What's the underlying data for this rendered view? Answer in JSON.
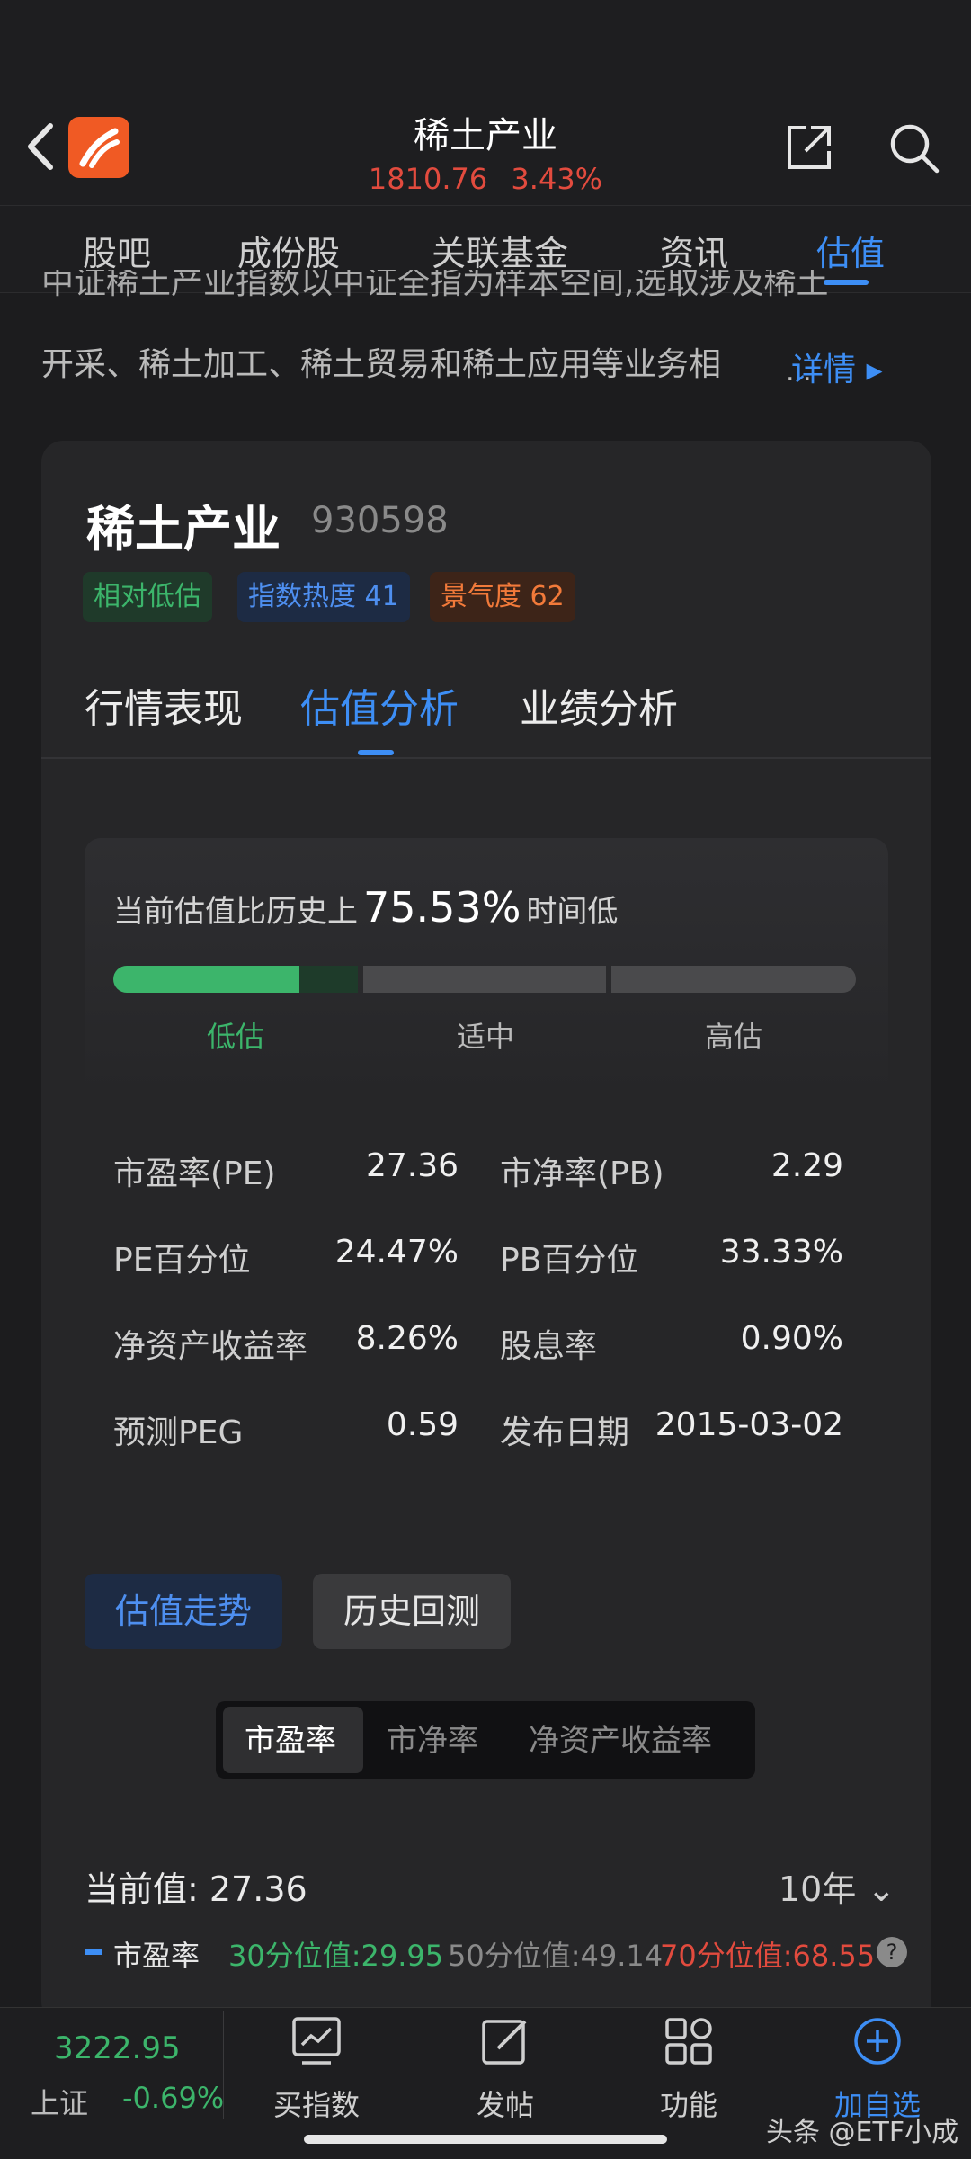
{
  "header": {
    "title": "稀土产业",
    "price": "1810.76",
    "change": "3.43%",
    "back_icon": "chevron-left-icon",
    "logo_icon": "app-logo-icon",
    "share_icon": "share-icon",
    "search_icon": "search-icon"
  },
  "tabs": [
    "股吧",
    "成份股",
    "关联基金",
    "资讯",
    "估值"
  ],
  "active_tab": "估值",
  "intro": {
    "line1": "中证稀土产业指数以中证全指为样本空间,选取涉及稀土",
    "line2": "开采、稀土加工、稀土贸易和稀土应用等业务相",
    "ellipsis": "...",
    "more_label": "详情 ▸"
  },
  "card": {
    "name": "稀土产业",
    "code": "930598",
    "tags": [
      "相对低估",
      "指数热度 41",
      "景气度 62"
    ],
    "subtabs": [
      "行情表现",
      "估值分析",
      "业绩分析"
    ],
    "active_subtab": "估值分析",
    "valuation": {
      "prefix": "当前估值比历史上",
      "percent": "75.53%",
      "suffix": "时间低",
      "zones": [
        "低估",
        "适中",
        "高估"
      ],
      "level": 0.25
    },
    "metrics": [
      {
        "label": "市盈率(PE)",
        "value": "27.36"
      },
      {
        "label": "市净率(PB)",
        "value": "2.29"
      },
      {
        "label": "PE百分位",
        "value": "24.47%"
      },
      {
        "label": "PB百分位",
        "value": "33.33%"
      },
      {
        "label": "净资产收益率",
        "value": "8.26%"
      },
      {
        "label": "股息率",
        "value": "0.90%"
      },
      {
        "label": "预测PEG",
        "value": "0.59"
      },
      {
        "label": "发布日期",
        "value": "2015-03-02"
      }
    ],
    "buttons": [
      "估值走势",
      "历史回测"
    ],
    "segments": [
      "市盈率",
      "市净率",
      "净资产收益率"
    ],
    "active_segment": "市盈率",
    "current_value": "当前值: 27.36",
    "period": "10年 ⌄",
    "legend": {
      "series": "市盈率",
      "p30": "30分位值:29.95",
      "p50": "50分位值:49.14",
      "p70": "70分位值:68.55",
      "help": "?"
    }
  },
  "bottom_bar": {
    "index_value": "3222.95",
    "index_name": "上证",
    "index_change": "-0.69%",
    "items": [
      {
        "label": "买指数",
        "icon": "chart-icon"
      },
      {
        "label": "发帖",
        "icon": "edit-icon"
      },
      {
        "label": "功能",
        "icon": "apps-icon"
      },
      {
        "label": "加自选",
        "icon": "plus-circle-icon"
      }
    ]
  },
  "watermark": "头条 @ETF小成",
  "colors": {
    "accent": "#3d8ef5",
    "up": "#e24b3e",
    "down": "#3cb56b",
    "warn": "#f27a3a"
  }
}
